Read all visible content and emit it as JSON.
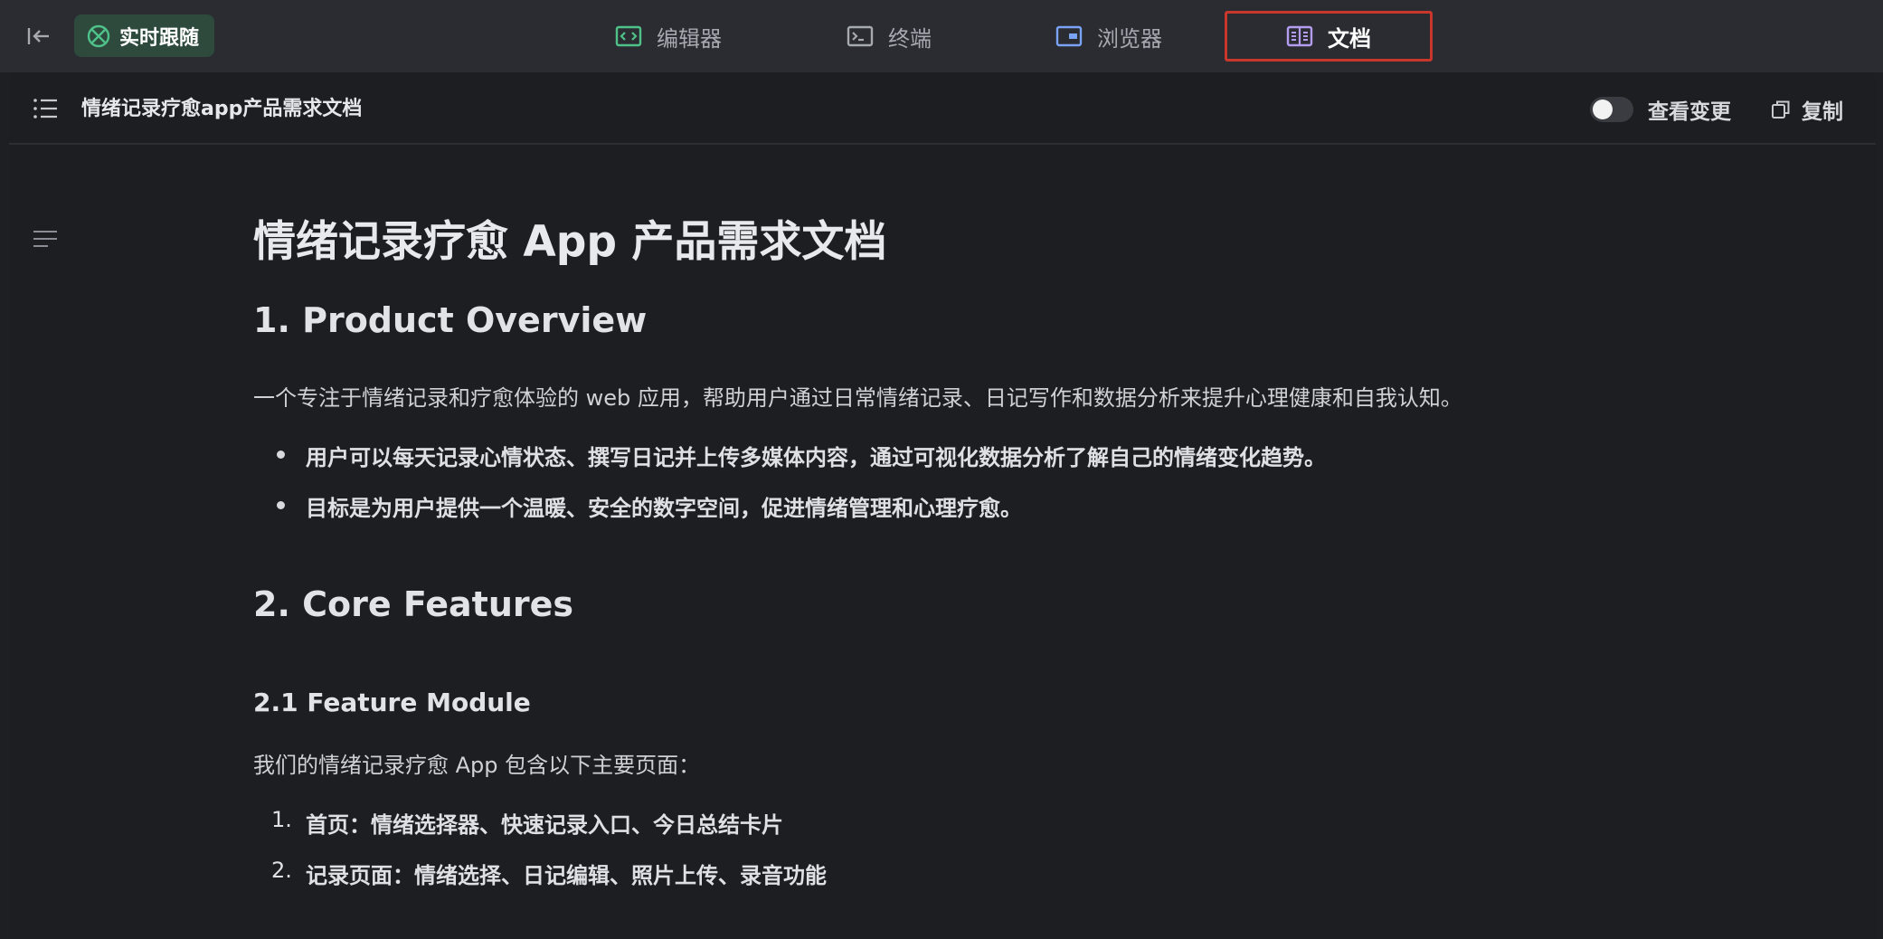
{
  "topbar": {
    "follow_label": "实时跟随",
    "tabs": [
      {
        "label": "编辑器",
        "icon": "code-icon"
      },
      {
        "label": "终端",
        "icon": "terminal-icon"
      },
      {
        "label": "浏览器",
        "icon": "browser-icon"
      },
      {
        "label": "文档",
        "icon": "document-icon",
        "active": true
      }
    ]
  },
  "doc_header": {
    "title": "情绪记录疗愈app产品需求文档",
    "view_changes_label": "查看变更",
    "view_changes_on": false,
    "copy_label": "复制"
  },
  "document": {
    "h1": "情绪记录疗愈 App 产品需求文档",
    "section1": {
      "heading": "1. Product Overview",
      "intro": "一个专注于情绪记录和疗愈体验的 web 应用，帮助用户通过日常情绪记录、日记写作和数据分析来提升心理健康和自我认知。",
      "bullets": [
        "用户可以每天记录心情状态、撰写日记并上传多媒体内容，通过可视化数据分析了解自己的情绪变化趋势。",
        "目标是为用户提供一个温暖、安全的数字空间，促进情绪管理和心理疗愈。"
      ]
    },
    "section2": {
      "heading": "2. Core Features",
      "sub_heading": "2.1 Feature Module",
      "intro": "我们的情绪记录疗愈 App 包含以下主要页面：",
      "items": [
        {
          "num": "1.",
          "text": "首页：情绪选择器、快速记录入口、今日总结卡片"
        },
        {
          "num": "2.",
          "text": "记录页面：情绪选择、日记编辑、照片上传、录音功能"
        }
      ]
    }
  },
  "colors": {
    "accent_green": "#2d4a3d",
    "active_tab_border": "#c9372c",
    "icon_purple": "#b49cf0",
    "icon_green": "#4fc28a",
    "icon_blue": "#7aa2f7"
  }
}
